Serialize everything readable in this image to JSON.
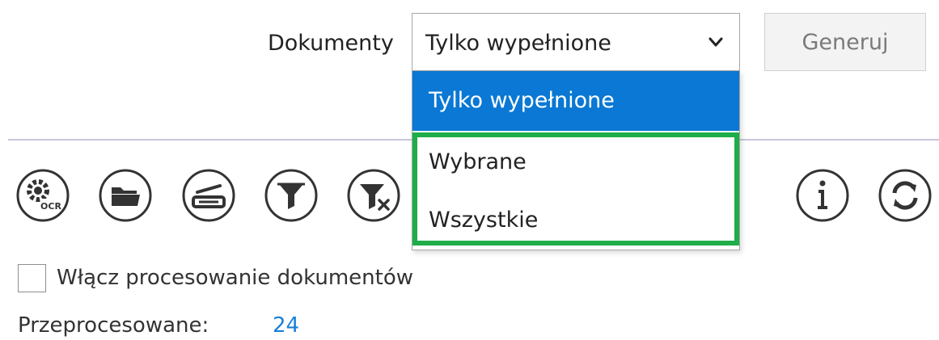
{
  "documents": {
    "label": "Dokumenty",
    "selected": "Tylko wypełnione",
    "options": [
      "Tylko wypełnione",
      "Wybrane",
      "Wszystkie"
    ]
  },
  "generate": {
    "label": "Generuj"
  },
  "toolbar": {
    "ocr_icon_text": "OCR",
    "icons": [
      "ocr-settings-icon",
      "folder-icon",
      "scanner-icon",
      "filter-icon",
      "clear-filter-icon",
      "info-icon",
      "refresh-icon"
    ]
  },
  "processing": {
    "checkbox_label": "Włącz procesowanie dokumentów",
    "checked": false
  },
  "processed": {
    "label": "Przeprocesowane:",
    "value": "24"
  },
  "colors": {
    "selected_option": "#0a78d4",
    "highlight_border": "#1fad49",
    "value_link": "#1a7fd8",
    "icon_stroke": "#333333"
  }
}
